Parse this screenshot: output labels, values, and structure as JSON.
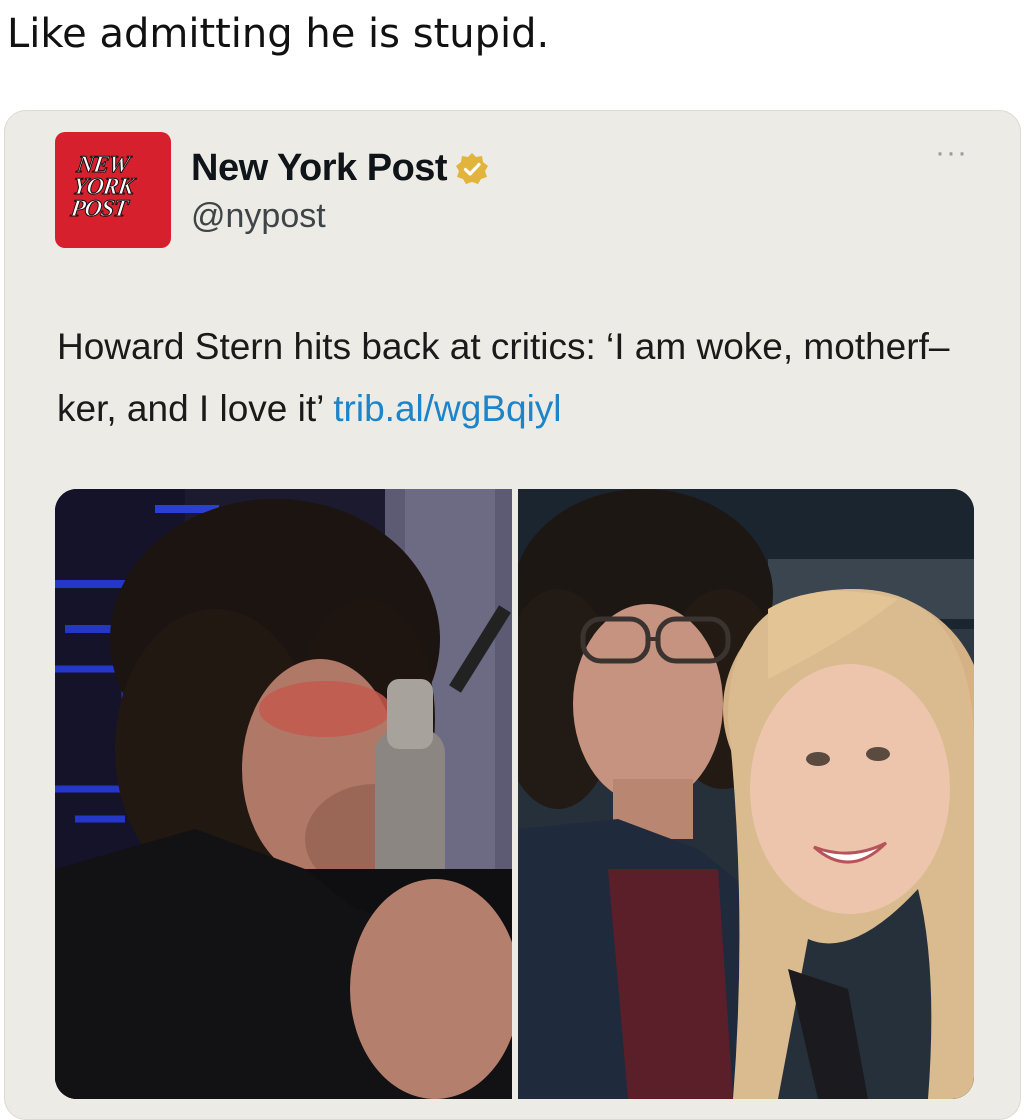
{
  "caption": "Like admitting he is stupid.",
  "tweet": {
    "account_name": "New York Post",
    "handle": "@nypost",
    "verified_badge_color": "#e2b33d",
    "avatar": {
      "logo_lines": [
        "NEW",
        "YORK",
        "POST"
      ],
      "background": "#d7202d"
    },
    "more_icon": "ellipsis-icon",
    "text": "Howard Stern hits back at critics: ‘I am woke, motherf–ker, and I love it’",
    "link_text": "trib.al/wgBqiyl",
    "link_color": "#1d84c9"
  },
  "media": {
    "count": 2,
    "images": [
      "man-at-microphone-photo",
      "man-and-woman-photo"
    ]
  }
}
